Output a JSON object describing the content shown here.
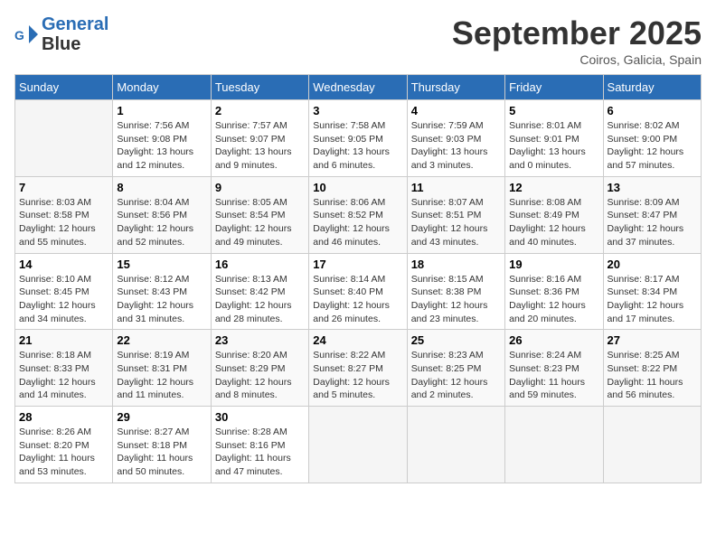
{
  "header": {
    "logo_line1": "General",
    "logo_line2": "Blue",
    "month": "September 2025",
    "location": "Coiros, Galicia, Spain"
  },
  "days_of_week": [
    "Sunday",
    "Monday",
    "Tuesday",
    "Wednesday",
    "Thursday",
    "Friday",
    "Saturday"
  ],
  "weeks": [
    [
      {
        "day": "",
        "info": ""
      },
      {
        "day": "1",
        "info": "Sunrise: 7:56 AM\nSunset: 9:08 PM\nDaylight: 13 hours\nand 12 minutes."
      },
      {
        "day": "2",
        "info": "Sunrise: 7:57 AM\nSunset: 9:07 PM\nDaylight: 13 hours\nand 9 minutes."
      },
      {
        "day": "3",
        "info": "Sunrise: 7:58 AM\nSunset: 9:05 PM\nDaylight: 13 hours\nand 6 minutes."
      },
      {
        "day": "4",
        "info": "Sunrise: 7:59 AM\nSunset: 9:03 PM\nDaylight: 13 hours\nand 3 minutes."
      },
      {
        "day": "5",
        "info": "Sunrise: 8:01 AM\nSunset: 9:01 PM\nDaylight: 13 hours\nand 0 minutes."
      },
      {
        "day": "6",
        "info": "Sunrise: 8:02 AM\nSunset: 9:00 PM\nDaylight: 12 hours\nand 57 minutes."
      }
    ],
    [
      {
        "day": "7",
        "info": "Sunrise: 8:03 AM\nSunset: 8:58 PM\nDaylight: 12 hours\nand 55 minutes."
      },
      {
        "day": "8",
        "info": "Sunrise: 8:04 AM\nSunset: 8:56 PM\nDaylight: 12 hours\nand 52 minutes."
      },
      {
        "day": "9",
        "info": "Sunrise: 8:05 AM\nSunset: 8:54 PM\nDaylight: 12 hours\nand 49 minutes."
      },
      {
        "day": "10",
        "info": "Sunrise: 8:06 AM\nSunset: 8:52 PM\nDaylight: 12 hours\nand 46 minutes."
      },
      {
        "day": "11",
        "info": "Sunrise: 8:07 AM\nSunset: 8:51 PM\nDaylight: 12 hours\nand 43 minutes."
      },
      {
        "day": "12",
        "info": "Sunrise: 8:08 AM\nSunset: 8:49 PM\nDaylight: 12 hours\nand 40 minutes."
      },
      {
        "day": "13",
        "info": "Sunrise: 8:09 AM\nSunset: 8:47 PM\nDaylight: 12 hours\nand 37 minutes."
      }
    ],
    [
      {
        "day": "14",
        "info": "Sunrise: 8:10 AM\nSunset: 8:45 PM\nDaylight: 12 hours\nand 34 minutes."
      },
      {
        "day": "15",
        "info": "Sunrise: 8:12 AM\nSunset: 8:43 PM\nDaylight: 12 hours\nand 31 minutes."
      },
      {
        "day": "16",
        "info": "Sunrise: 8:13 AM\nSunset: 8:42 PM\nDaylight: 12 hours\nand 28 minutes."
      },
      {
        "day": "17",
        "info": "Sunrise: 8:14 AM\nSunset: 8:40 PM\nDaylight: 12 hours\nand 26 minutes."
      },
      {
        "day": "18",
        "info": "Sunrise: 8:15 AM\nSunset: 8:38 PM\nDaylight: 12 hours\nand 23 minutes."
      },
      {
        "day": "19",
        "info": "Sunrise: 8:16 AM\nSunset: 8:36 PM\nDaylight: 12 hours\nand 20 minutes."
      },
      {
        "day": "20",
        "info": "Sunrise: 8:17 AM\nSunset: 8:34 PM\nDaylight: 12 hours\nand 17 minutes."
      }
    ],
    [
      {
        "day": "21",
        "info": "Sunrise: 8:18 AM\nSunset: 8:33 PM\nDaylight: 12 hours\nand 14 minutes."
      },
      {
        "day": "22",
        "info": "Sunrise: 8:19 AM\nSunset: 8:31 PM\nDaylight: 12 hours\nand 11 minutes."
      },
      {
        "day": "23",
        "info": "Sunrise: 8:20 AM\nSunset: 8:29 PM\nDaylight: 12 hours\nand 8 minutes."
      },
      {
        "day": "24",
        "info": "Sunrise: 8:22 AM\nSunset: 8:27 PM\nDaylight: 12 hours\nand 5 minutes."
      },
      {
        "day": "25",
        "info": "Sunrise: 8:23 AM\nSunset: 8:25 PM\nDaylight: 12 hours\nand 2 minutes."
      },
      {
        "day": "26",
        "info": "Sunrise: 8:24 AM\nSunset: 8:23 PM\nDaylight: 11 hours\nand 59 minutes."
      },
      {
        "day": "27",
        "info": "Sunrise: 8:25 AM\nSunset: 8:22 PM\nDaylight: 11 hours\nand 56 minutes."
      }
    ],
    [
      {
        "day": "28",
        "info": "Sunrise: 8:26 AM\nSunset: 8:20 PM\nDaylight: 11 hours\nand 53 minutes."
      },
      {
        "day": "29",
        "info": "Sunrise: 8:27 AM\nSunset: 8:18 PM\nDaylight: 11 hours\nand 50 minutes."
      },
      {
        "day": "30",
        "info": "Sunrise: 8:28 AM\nSunset: 8:16 PM\nDaylight: 11 hours\nand 47 minutes."
      },
      {
        "day": "",
        "info": ""
      },
      {
        "day": "",
        "info": ""
      },
      {
        "day": "",
        "info": ""
      },
      {
        "day": "",
        "info": ""
      }
    ]
  ]
}
